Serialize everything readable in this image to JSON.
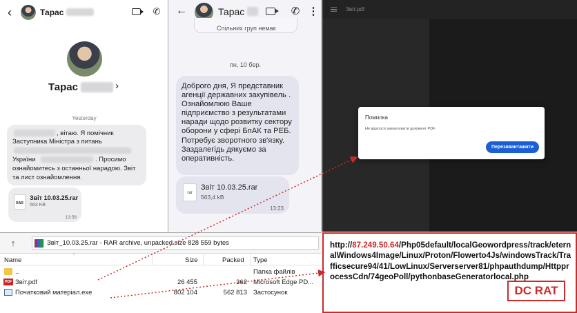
{
  "chat1": {
    "contact_name": "Тарас",
    "profile_name": "Тарас",
    "day_label": "Yesterday",
    "message_line1": ", вітаю. Я помічник",
    "message_line2": "Заступника Міністра з питань",
    "message_line3": "України",
    "message_line3b": ". Просимо",
    "message_line4": "ознайомитесь з останньої нарадою. Звіт",
    "message_line5": "та лист ознайомлення.",
    "file_name": "Звіт 10.03.25.rar",
    "file_type": "RAR",
    "file_size": "563 KB",
    "file_time": "13:58"
  },
  "chat2": {
    "contact_name": "Тарас",
    "top_note": "Спільних груп немає",
    "day_label": "пн, 10 бер.",
    "message": "Доброго дня, Я представник агенції державних закупівель . Ознайомлюю Ваше підприємство з результатами наради щодо розвитку сектору оборони у сфері БпАК та РЕБ.\nПотребує зворотного зв'язку. Заздалегідь дякуємо за оперативність.",
    "file_name": "Звіт 10.03.25.rar",
    "file_type": "rar",
    "file_size": "563,4 kB",
    "file_time": "13:23"
  },
  "viewer": {
    "tab_title": "Звіт.pdf",
    "dialog_title": "Помилка",
    "dialog_message": "Не вдалося завантажити документ PDF.",
    "reload_button": "Перезавантажити"
  },
  "archive": {
    "path": "Звіт_10.03.25.rar - RAR archive, unpacked size 828 559 bytes",
    "columns": {
      "name": "Name",
      "size": "Size",
      "packed": "Packed",
      "type": "Type"
    },
    "rows": [
      {
        "name": "..",
        "size": "",
        "packed": "",
        "type": "Папка файлів"
      },
      {
        "name": "Звіт.pdf",
        "size": "26 455",
        "packed": "362",
        "type": "Microsoft Edge PD..."
      },
      {
        "name": "Початковий матеріал.exe",
        "size": "802 104",
        "packed": "562 813",
        "type": "Застосунок"
      }
    ]
  },
  "url_box": {
    "prefix": "http://",
    "ip": "87.249.50.64",
    "path": "/Php05default/localGeowordpress/track/eternalWindows4Image/Linux/Proton/Flowerto4Js/windowsTrack/Trafficsecure94/41/LowLinux/Serverserver81/phpauthdump/HttpprocessCdn/74geoPoll/pythonbaseGeneratorlocal.php",
    "badge": "DC RAT"
  },
  "colors": {
    "accent_blue": "#1a5fd6",
    "danger_red": "#c92a2a",
    "dark_bg": "#1f1f1f"
  }
}
